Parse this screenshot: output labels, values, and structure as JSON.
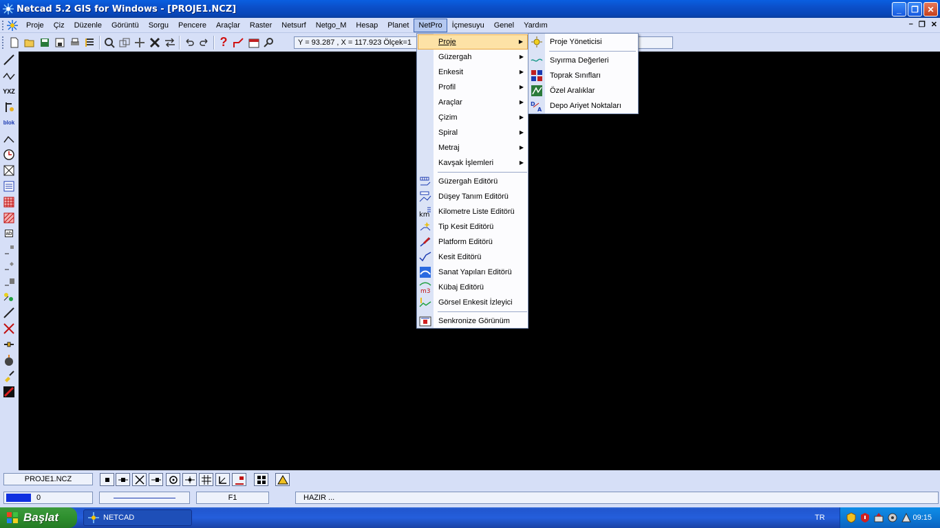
{
  "window": {
    "title": "Netcad 5.2 GIS for Windows - [PROJE1.NCZ]"
  },
  "menubar": {
    "items": [
      "Proje",
      "Çiz",
      "Düzenle",
      "Görüntü",
      "Sorgu",
      "Pencere",
      "Araçlar",
      "Raster",
      "Netsurf",
      "Netgo_M",
      "Hesap",
      "Planet",
      "NetPro",
      "İçmesuyu",
      "Genel",
      "Yardım"
    ],
    "active": "NetPro"
  },
  "toolbar": {
    "coordinates": "Y = 93.287 , X = 117.923  Ölçek=1"
  },
  "netpro_menu": {
    "submenus": [
      "Proje",
      "Güzergah",
      "Enkesit",
      "Profil",
      "Araçlar",
      "Çizim",
      "Spiral",
      "Metraj",
      "Kavşak İşlemleri"
    ],
    "editors": [
      "Güzergah Editörü",
      "Düşey Tanım Editörü",
      "Kilometre Liste Editörü",
      "Tip Kesit Editörü",
      "Platform Editörü",
      "Kesit Editörü",
      "Sanat Yapıları Editörü",
      "Kübaj Editörü",
      "Görsel Enkesit İzleyici"
    ],
    "sync": "Senkronize Görünüm"
  },
  "proje_submenu": {
    "top": "Proje Yöneticisi",
    "items": [
      "Sıyırma Değerleri",
      "Toprak Sınıfları",
      "Özel Aralıklar",
      "Depo Ariyet Noktaları"
    ]
  },
  "bottombar": {
    "document_tab": "PROJE1.NCZ"
  },
  "statusbar": {
    "layer": "0",
    "function_key": "F1",
    "status": "HAZIR ..."
  },
  "taskbar": {
    "start": "Başlat",
    "task": "NETCAD",
    "language": "TR",
    "clock": "09:15"
  },
  "colors": {
    "titlebar": "#0a5fe0",
    "canvas": "#000000",
    "menu_highlight": "#fde2a6",
    "taskbar": "#245edb",
    "start": "#3c9a3c"
  }
}
